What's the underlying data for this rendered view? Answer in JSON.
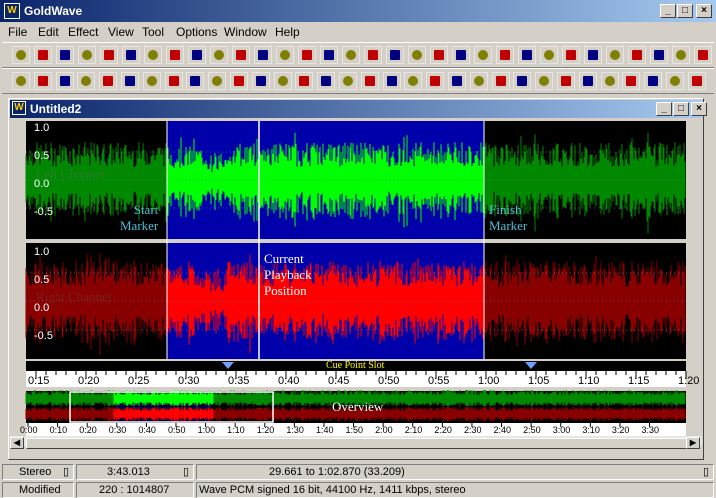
{
  "app": {
    "title": "GoldWave",
    "icon_letter": "W"
  },
  "menu": [
    "File",
    "Edit",
    "Effect",
    "View",
    "Tool",
    "Options",
    "Window",
    "Help"
  ],
  "document": {
    "title": "Untitled2"
  },
  "channels": {
    "left": {
      "label": "Left Channel",
      "y_ticks": [
        "1.0",
        "0.5",
        "0.0",
        "-0.5"
      ]
    },
    "right": {
      "label": "Right Channel",
      "y_ticks": [
        "1.0",
        "0.5",
        "0.0",
        "-0.5"
      ]
    }
  },
  "markers": {
    "start": "Start\nMarker",
    "finish": "Finish\nMarker",
    "playback": "Current\nPlayback\nPosition",
    "cue_slot": "Cue Point Slot"
  },
  "timeline": {
    "ticks": [
      "0:15",
      "0:20",
      "0:25",
      "0:30",
      "0:35",
      "0:40",
      "0:45",
      "0:50",
      "0:55",
      "1:00",
      "1:05",
      "1:10",
      "1:15",
      "1:20"
    ]
  },
  "overview": {
    "label": "Overview",
    "ticks": [
      "0:00",
      "0:10",
      "0:20",
      "0:30",
      "0:40",
      "0:50",
      "1:00",
      "1:10",
      "1:20",
      "1:30",
      "1:40",
      "1:50",
      "2:00",
      "2:10",
      "2:20",
      "2:30",
      "2:40",
      "2:50",
      "3:00",
      "3:10",
      "3:20",
      "3:30"
    ]
  },
  "status": {
    "channels": "Stereo",
    "duration": "3:43.013",
    "selection": "29.661 to 1:02.870 (33.209)",
    "state": "Modified",
    "ratio": "220 : 1014807",
    "format": "Wave PCM signed 16 bit, 44100 Hz, 1411 kbps, stereo"
  },
  "colors": {
    "left_bright": "#00ff00",
    "left_dim": "#008800",
    "right_bright": "#ff0000",
    "right_dim": "#880000",
    "selection_bg": "#0000aa",
    "bg": "#000000",
    "marker_text": "#4ec0d8"
  }
}
